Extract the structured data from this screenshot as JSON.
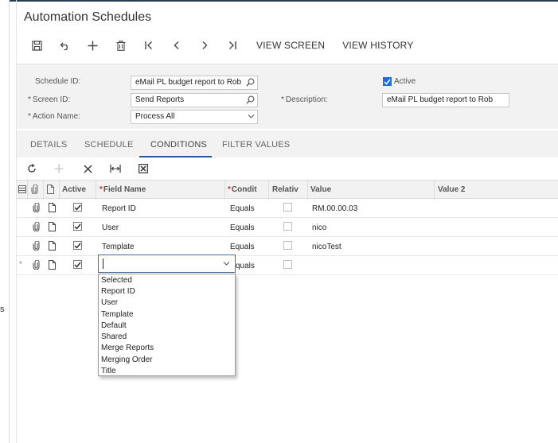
{
  "page": {
    "title": "Automation Schedules",
    "edge_letter": "s"
  },
  "toolbar": {
    "buttons": [
      "save-icon",
      "undo-icon",
      "add-icon",
      "delete-icon",
      "first-record-icon",
      "prev-record-icon",
      "next-record-icon",
      "last-record-icon"
    ],
    "view_screen": "VIEW SCREEN",
    "view_history": "VIEW HISTORY"
  },
  "form": {
    "schedule_id_label": "Schedule ID:",
    "schedule_id_value": "eMail PL budget report to Rob",
    "screen_id_label": "Screen ID:",
    "screen_id_value": "Send Reports",
    "action_name_label": "Action Name:",
    "action_name_value": "Process All",
    "active_label": "Active",
    "active_checked": true,
    "description_label": "Description:",
    "description_value": "eMail PL budget report to Rob",
    "required_mark": "*"
  },
  "tabs": {
    "details": "DETAILS",
    "schedule": "SCHEDULE",
    "conditions": "CONDITIONS",
    "filter_values": "FILTER VALUES",
    "active": "conditions"
  },
  "grid": {
    "headers": {
      "active": "Active",
      "field_name": "Field Name",
      "condition": "Condit",
      "relative": "Relativ",
      "value": "Value",
      "value2": "Value 2",
      "required_mark": "*"
    },
    "rows": [
      {
        "active": true,
        "field": "Report ID",
        "condition": "Equals",
        "relative": false,
        "value": "RM.00.00.03"
      },
      {
        "active": true,
        "field": "User",
        "condition": "Equals",
        "relative": false,
        "value": "nico"
      },
      {
        "active": true,
        "field": "Template",
        "condition": "Equals",
        "relative": false,
        "value": "nicoTest"
      }
    ],
    "new_row": {
      "row_marker": "*",
      "active": true,
      "condition": "quals",
      "relative": false
    }
  },
  "dropdown": {
    "options": [
      "Selected",
      "Report ID",
      "User",
      "Template",
      "Default",
      "Shared",
      "Merge Reports",
      "Merging Order",
      "Title"
    ]
  }
}
